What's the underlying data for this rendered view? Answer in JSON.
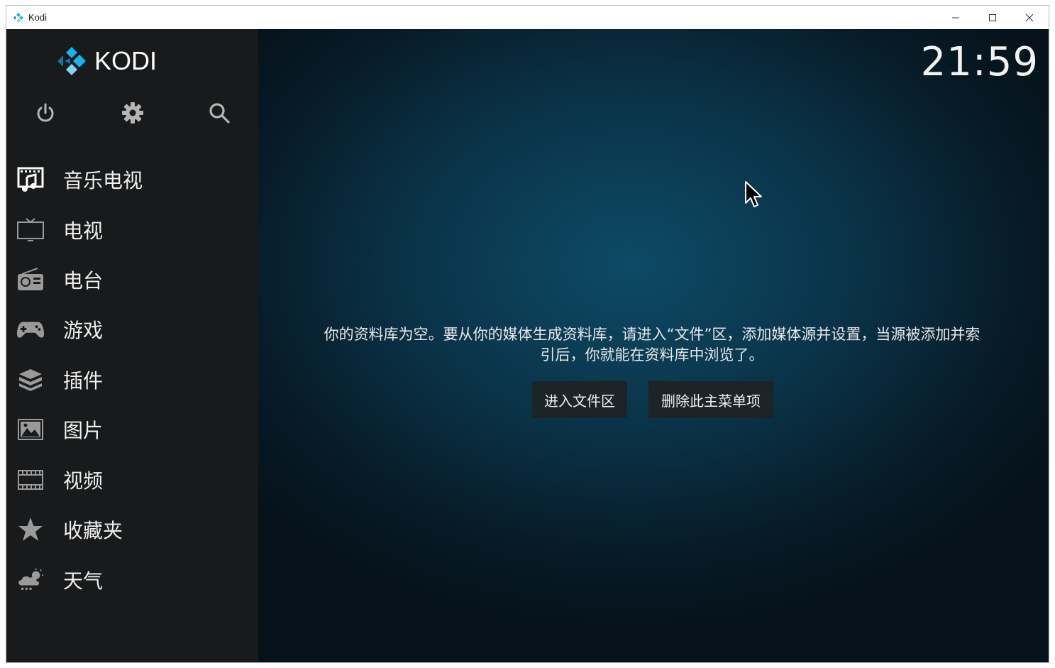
{
  "window": {
    "title": "Kodi"
  },
  "brand": {
    "logo_text": "KODI",
    "colors": {
      "logo_blue": "#17b2e7",
      "logo_light": "#7fd5f4",
      "logo_dark": "#1276a8"
    }
  },
  "top_icons": [
    "power-icon",
    "gear-icon",
    "search-icon"
  ],
  "clock": "21:59",
  "menu": {
    "items": [
      {
        "label": "音乐电视",
        "icon": "music-video-icon"
      },
      {
        "label": "电视",
        "icon": "tv-icon"
      },
      {
        "label": "电台",
        "icon": "radio-icon"
      },
      {
        "label": "游戏",
        "icon": "gamepad-icon"
      },
      {
        "label": "插件",
        "icon": "addons-box-icon"
      },
      {
        "label": "图片",
        "icon": "picture-icon"
      },
      {
        "label": "视频",
        "icon": "film-icon"
      },
      {
        "label": "收藏夹",
        "icon": "star-icon"
      },
      {
        "label": "天气",
        "icon": "weather-cloud-icon"
      }
    ]
  },
  "main": {
    "message_line1": "你的资料库为空。要从你的媒体生成资料库，请进入“文件”区，添加媒体源并设置，当源被添加并索",
    "message_line2": "引后，你就能在资料库中浏览了。",
    "buttons": {
      "files": "进入文件区",
      "remove": "删除此主菜单项"
    }
  }
}
